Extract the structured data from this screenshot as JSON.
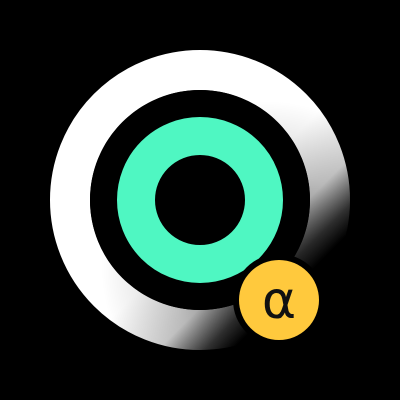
{
  "icon": {
    "name": "target-rings-app-icon",
    "colors": {
      "background": "#000000",
      "outer_ring": "#ffffff",
      "outer_ring_shadow": "#1a1a1a",
      "inner_ring": "#4ff7c2",
      "badge_fill": "#ffc93d",
      "badge_glyph": "#111111"
    }
  },
  "badge": {
    "icon_name": "alpha-badge-icon",
    "symbol": "α"
  }
}
